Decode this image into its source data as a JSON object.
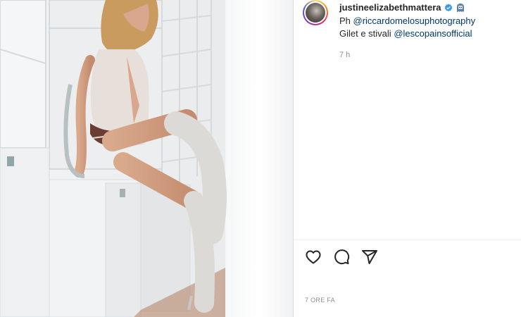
{
  "post": {
    "username": "justineelizabethmattera",
    "verified_icon": "verified-badge-icon",
    "emoji_icon": "ghost-emoji-icon",
    "caption_line1_prefix": "Ph ",
    "caption_line1_mention": "@riccardomelosuphotography",
    "caption_line2_prefix": "Gilet e stivali ",
    "caption_line2_mention": "@lescopainsofficial",
    "comment_time": "7 h",
    "post_time": "7 ORE FA"
  },
  "actions": {
    "like_icon": "heart-icon",
    "comment_icon": "comment-icon",
    "share_icon": "share-icon"
  },
  "colors": {
    "text": "#262626",
    "mention": "#00376b",
    "muted": "#8e8e8e",
    "verified": "#3897f0"
  }
}
